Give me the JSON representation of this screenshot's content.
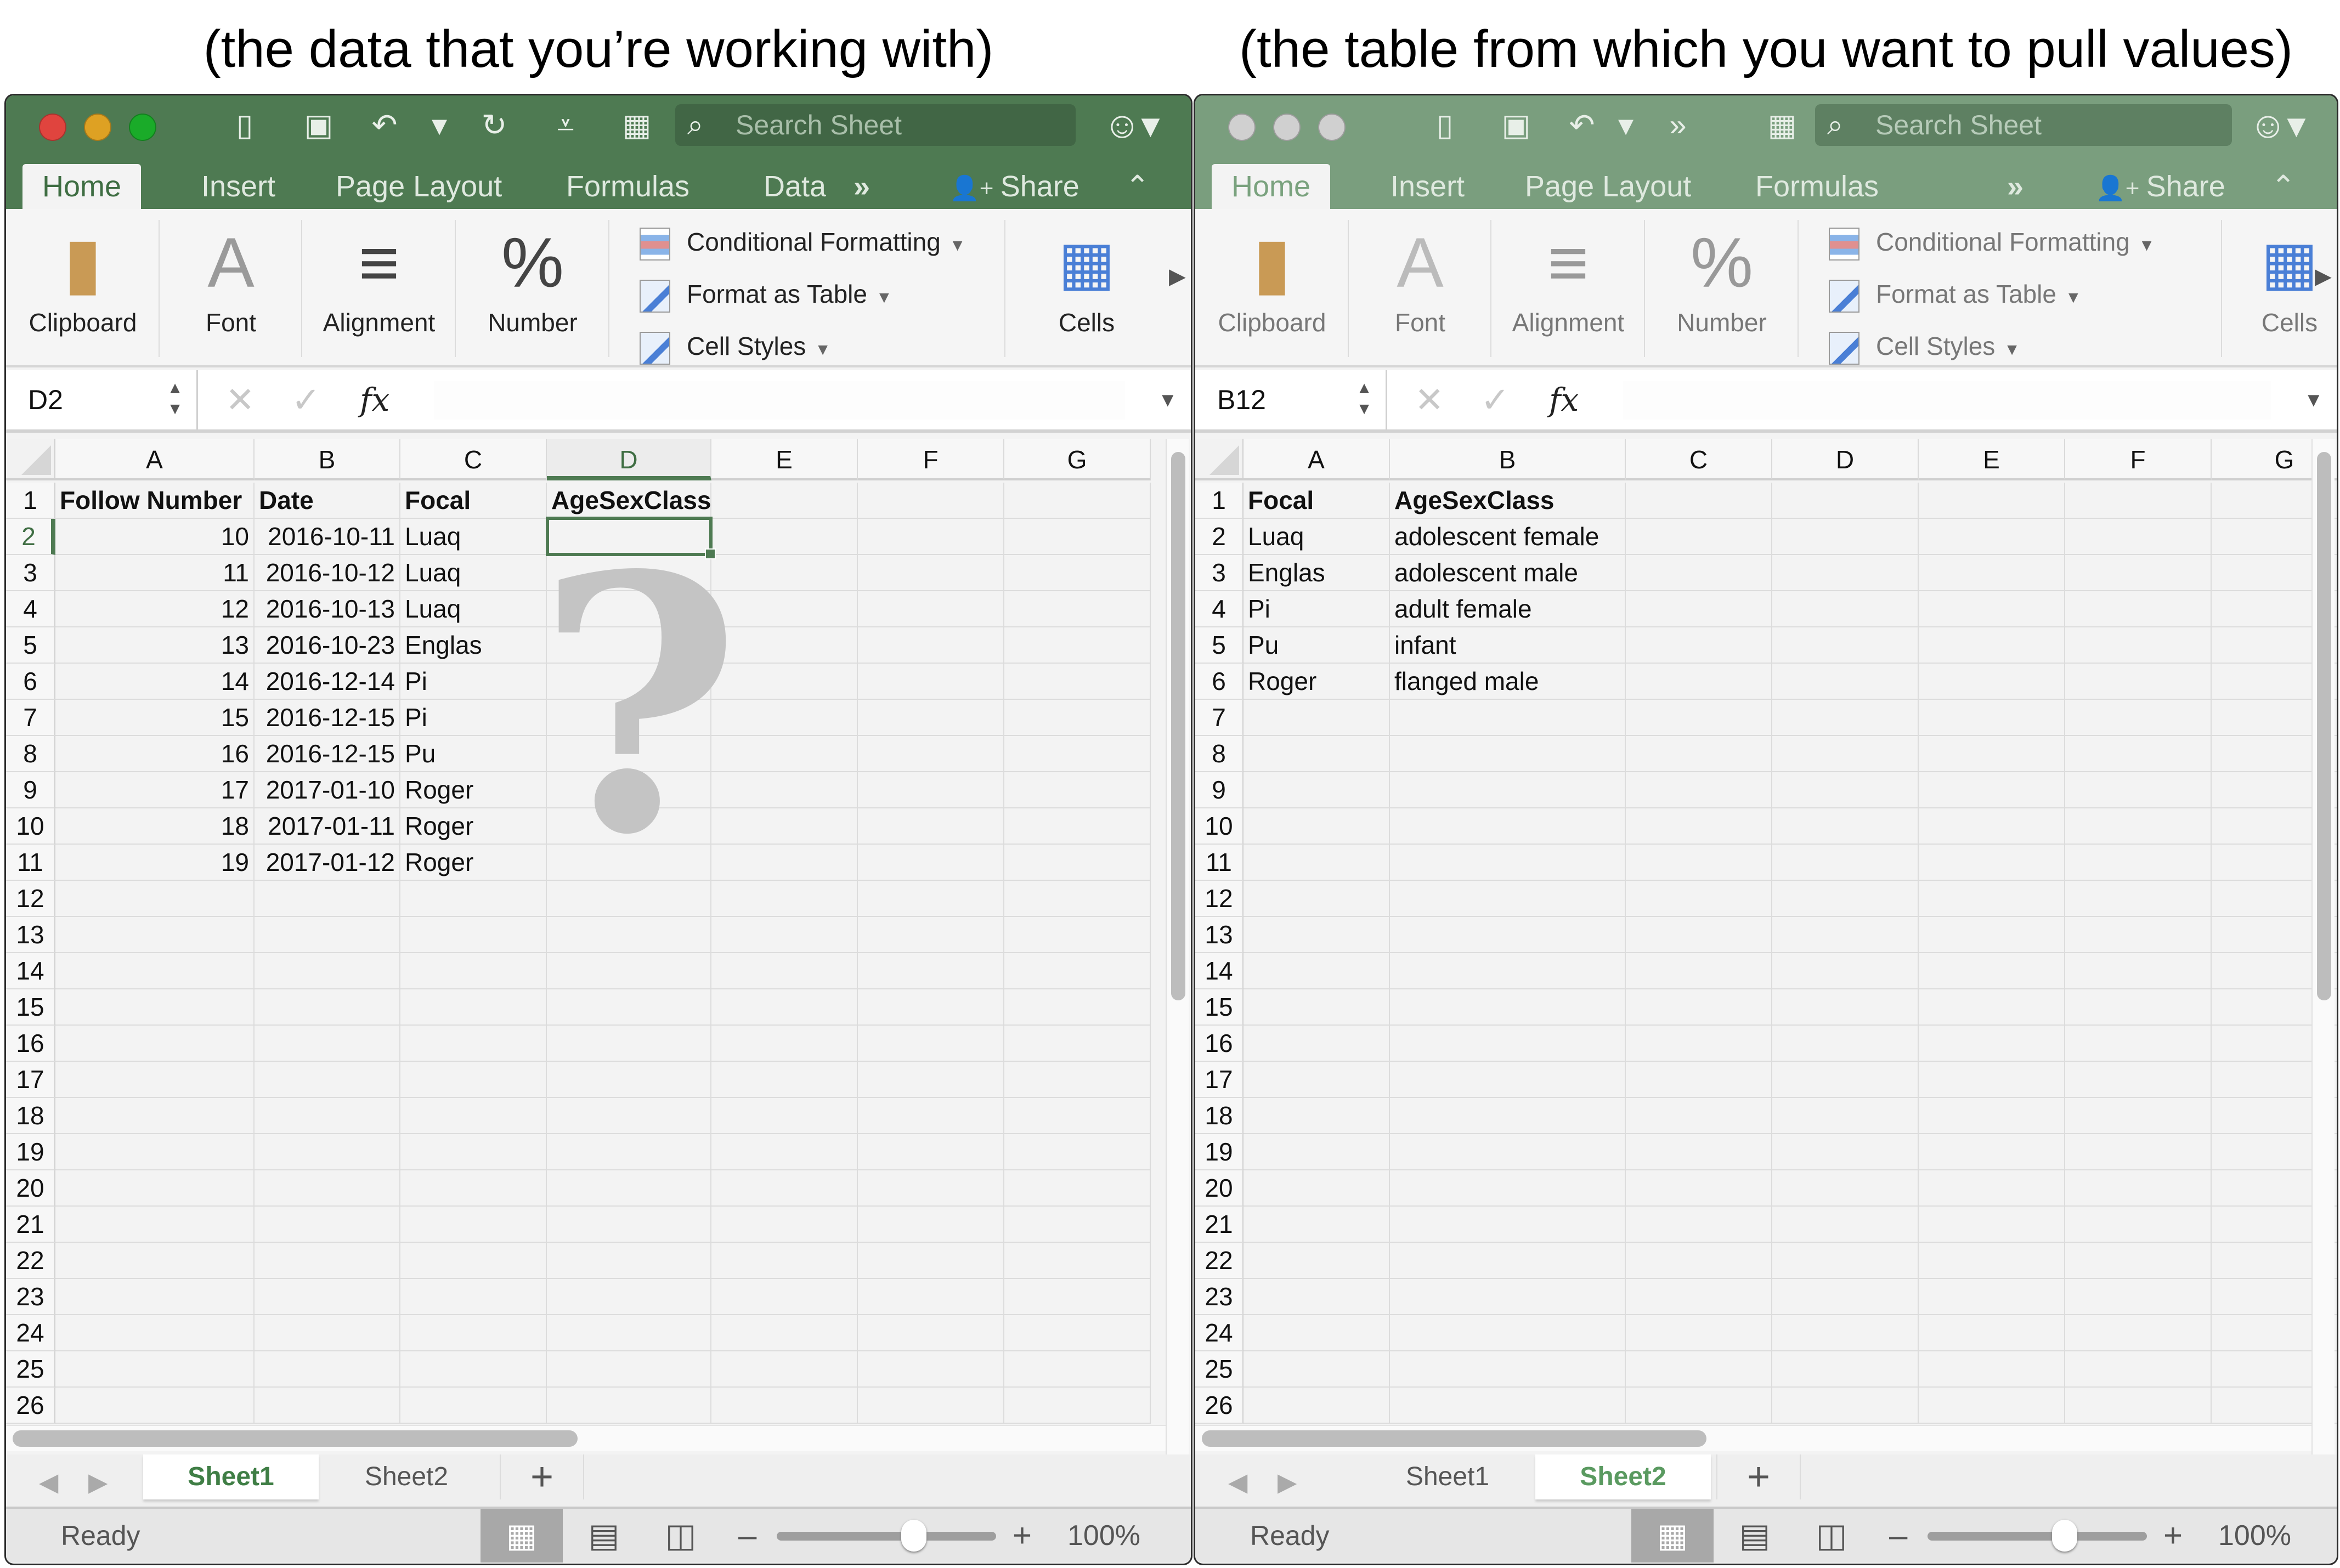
{
  "captions": {
    "left": "(the data that you’re working with)",
    "right": "(the table from which you want to pull values)"
  },
  "left_window": {
    "state": "active",
    "search_placeholder": "Search Sheet",
    "tabs": [
      "Home",
      "Insert",
      "Page Layout",
      "Formulas",
      "Data"
    ],
    "overflow": "»",
    "share_label": "Share",
    "ribbon": {
      "clipboard": "Clipboard",
      "font": "Font",
      "alignment": "Alignment",
      "number": "Number",
      "conditional_formatting": "Conditional Formatting",
      "format_as_table": "Format as Table",
      "cell_styles": "Cell Styles",
      "cells": "Cells"
    },
    "name_box": "D2",
    "formula": "",
    "fx": "fx",
    "columns": [
      "A",
      "B",
      "C",
      "D",
      "E",
      "F",
      "G"
    ],
    "selected_column": "D",
    "selected_row": 2,
    "rows": [
      "1",
      "2",
      "3",
      "4",
      "5",
      "6",
      "7",
      "8",
      "9",
      "10",
      "11",
      "12",
      "13",
      "14",
      "15",
      "16",
      "17",
      "18",
      "19",
      "20",
      "21",
      "22",
      "23",
      "24",
      "25",
      "26"
    ],
    "header": [
      "Follow Number",
      "Date",
      "Focal",
      "AgeSexClass"
    ],
    "data": [
      [
        "10",
        "2016-10-11",
        "Luaq",
        ""
      ],
      [
        "11",
        "2016-10-12",
        "Luaq",
        ""
      ],
      [
        "12",
        "2016-10-13",
        "Luaq",
        ""
      ],
      [
        "13",
        "2016-10-23",
        "Englas",
        ""
      ],
      [
        "14",
        "2016-12-14",
        "Pi",
        ""
      ],
      [
        "15",
        "2016-12-15",
        "Pi",
        ""
      ],
      [
        "16",
        "2016-12-15",
        "Pu",
        ""
      ],
      [
        "17",
        "2017-01-10",
        "Roger",
        ""
      ],
      [
        "18",
        "2017-01-11",
        "Roger",
        ""
      ],
      [
        "19",
        "2017-01-12",
        "Roger",
        ""
      ]
    ],
    "overlay": "?",
    "sheets": [
      "Sheet1",
      "Sheet2"
    ],
    "active_sheet": "Sheet1",
    "status": "Ready",
    "zoom": "100%",
    "zoom_percent": 100
  },
  "right_window": {
    "state": "inactive",
    "search_placeholder": "Search Sheet",
    "tabs": [
      "Home",
      "Insert",
      "Page Layout",
      "Formulas"
    ],
    "overflow": "»",
    "share_label": "Share",
    "ribbon": {
      "clipboard": "Clipboard",
      "font": "Font",
      "alignment": "Alignment",
      "number": "Number",
      "conditional_formatting": "Conditional Formatting",
      "format_as_table": "Format as Table",
      "cell_styles": "Cell Styles",
      "cells": "Cells"
    },
    "name_box": "B12",
    "formula": "",
    "fx": "fx",
    "columns": [
      "A",
      "B",
      "C",
      "D",
      "E",
      "F",
      "G"
    ],
    "rows": [
      "1",
      "2",
      "3",
      "4",
      "5",
      "6",
      "7",
      "8",
      "9",
      "10",
      "11",
      "12",
      "13",
      "14",
      "15",
      "16",
      "17",
      "18",
      "19",
      "20",
      "21",
      "22",
      "23",
      "24",
      "25",
      "26"
    ],
    "header": [
      "Focal",
      "AgeSexClass"
    ],
    "data": [
      [
        "Luaq",
        "adolescent female"
      ],
      [
        "Englas",
        "adolescent male"
      ],
      [
        "Pi",
        "adult female"
      ],
      [
        "Pu",
        "infant"
      ],
      [
        "Roger",
        "flanged male"
      ]
    ],
    "sheets": [
      "Sheet1",
      "Sheet2"
    ],
    "active_sheet": "Sheet2",
    "status": "Ready",
    "zoom": "100%",
    "zoom_percent": 100
  },
  "colors": {
    "excel_green": "#4e7a52",
    "excel_green_inactive": "#7a9e7e",
    "selection": "#4e7a52",
    "traffic_red": "#e0443e",
    "traffic_yellow": "#dea123",
    "traffic_green": "#1aab29",
    "traffic_inactive": "#d0d0d0"
  }
}
